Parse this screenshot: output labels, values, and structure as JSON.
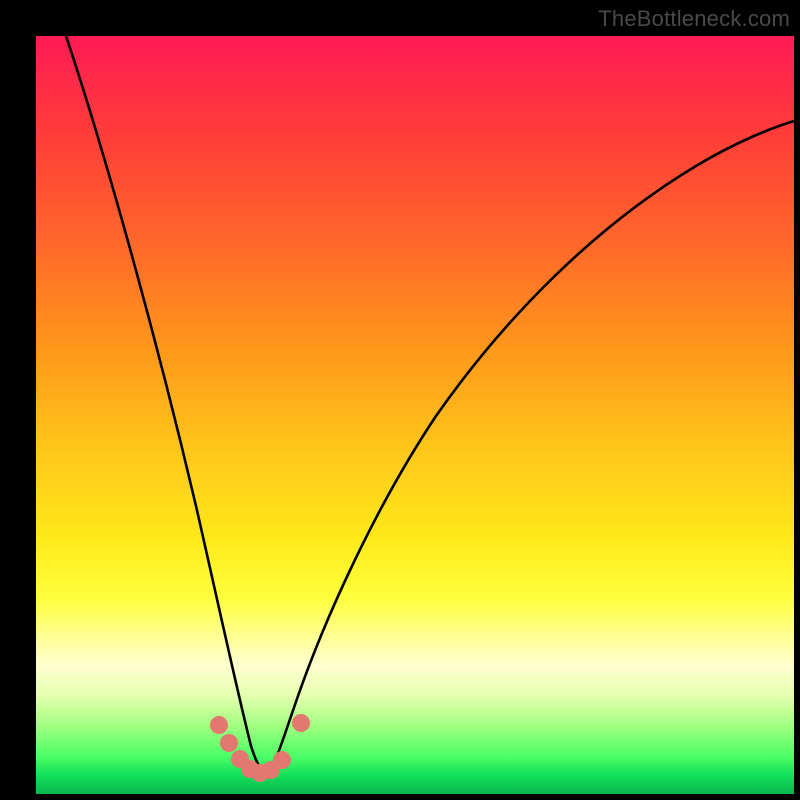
{
  "watermark": "TheBottleneck.com",
  "chart_data": {
    "type": "line",
    "title": "",
    "xlabel": "",
    "ylabel": "",
    "xlim": [
      0,
      100
    ],
    "ylim": [
      0,
      100
    ],
    "grid": false,
    "legend": false,
    "series": [
      {
        "name": "bottleneck-curve",
        "x": [
          4,
          8,
          12,
          16,
          20,
          22,
          24,
          26,
          27,
          28,
          29,
          30,
          31,
          33,
          36,
          40,
          45,
          50,
          56,
          62,
          70,
          78,
          86,
          94,
          100
        ],
        "values": [
          100,
          83,
          66,
          49,
          31,
          22,
          14,
          7,
          4,
          2,
          1,
          1,
          2,
          6,
          13,
          22,
          32,
          41,
          50,
          58,
          66,
          73,
          79,
          84,
          87
        ]
      }
    ],
    "markers": [
      {
        "x": 23.5,
        "y": 9
      },
      {
        "x": 24.5,
        "y": 6
      },
      {
        "x": 26.0,
        "y": 3.5
      },
      {
        "x": 27.5,
        "y": 2
      },
      {
        "x": 29.0,
        "y": 1.5
      },
      {
        "x": 30.5,
        "y": 2
      },
      {
        "x": 32.0,
        "y": 3.5
      },
      {
        "x": 34.5,
        "y": 9
      }
    ],
    "marker_color": "#e2786f",
    "curve_color": "#000000"
  }
}
